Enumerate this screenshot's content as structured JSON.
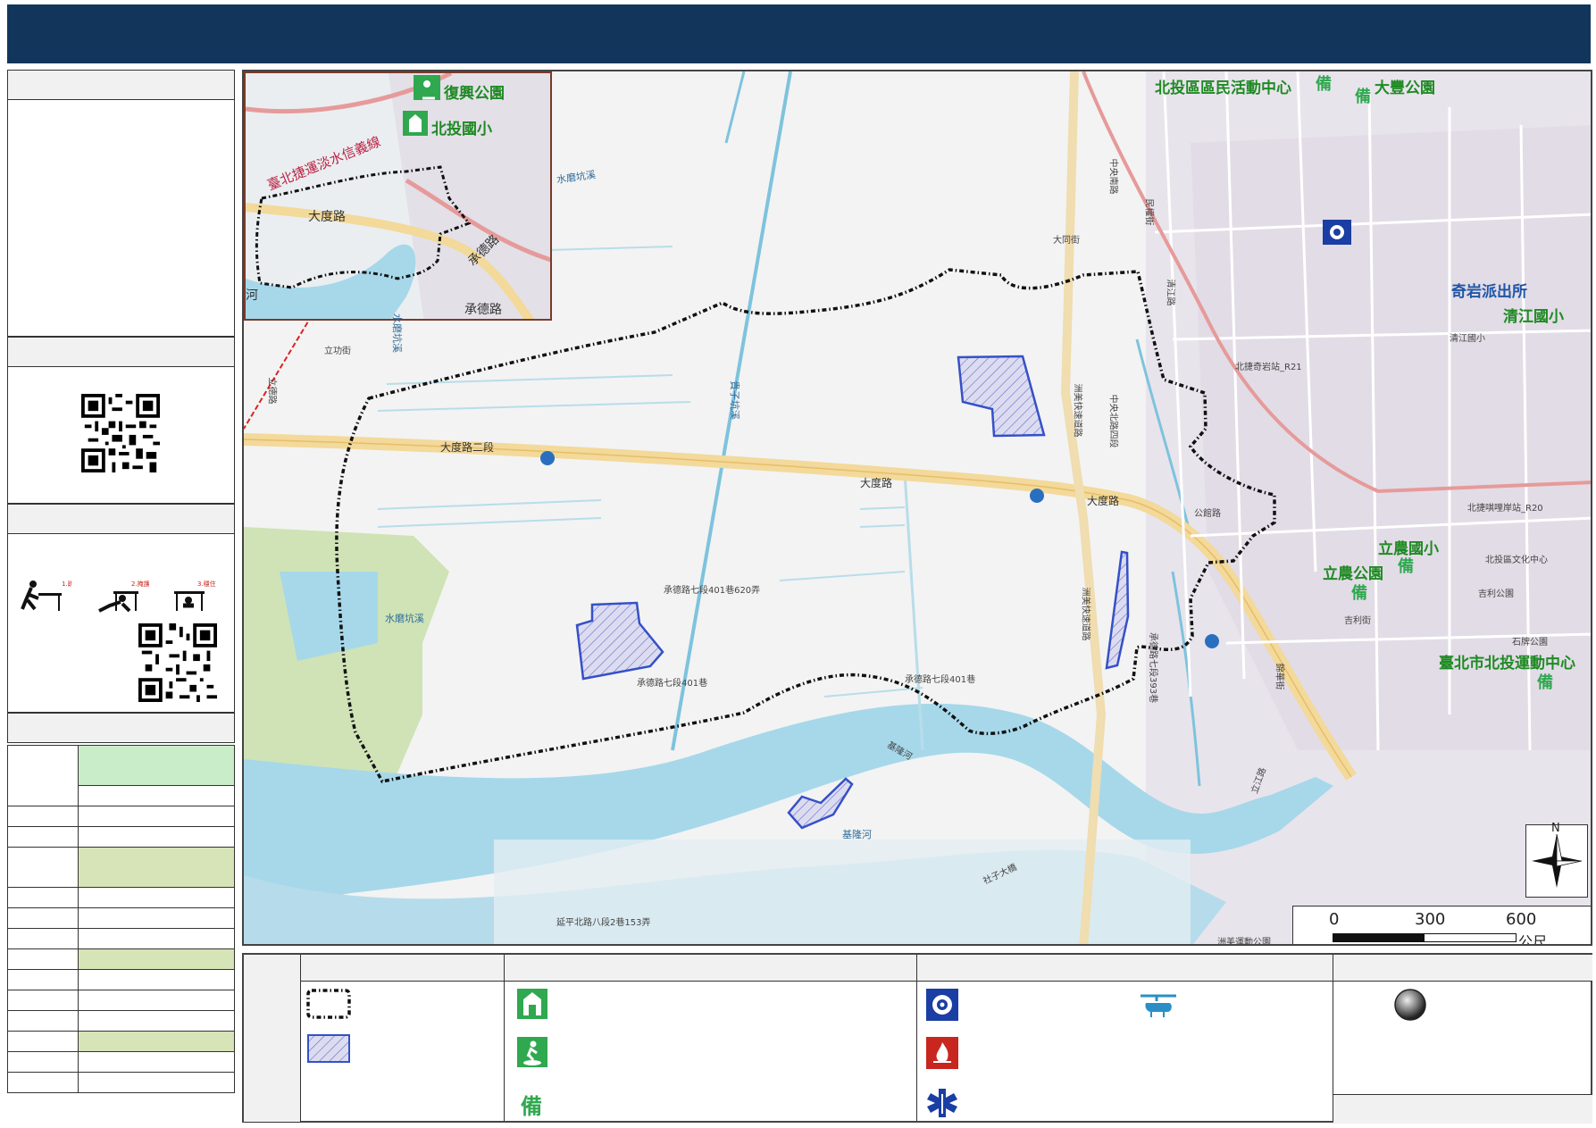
{
  "map": {
    "inset_labels": {
      "park": "復興公園",
      "school": "北投國小",
      "metro_line": "臺北捷運淡水信義線",
      "road_dadu": "大度路",
      "road_chengde": "承德路",
      "road_chengde2": "承德路",
      "river": "河"
    },
    "facility_labels": {
      "activity_center": "北投區區民活動中心",
      "dafeng_park": "大豐公園",
      "qiyan_police": "奇岩派出所",
      "qingjiang_school": "清江國小",
      "linong_school": "立農國小",
      "linong_park": "立農公園",
      "sports_center": "臺北市北投運動中心",
      "bei": "備"
    },
    "road_labels": {
      "dadu_2": "大度路二段",
      "dadu": "大度路",
      "dadu_b": "大度路",
      "chengde_620": "承德路七段401巷620弄",
      "chengde_401": "承德路七段401巷",
      "chengde_401b": "承德路七段401巷",
      "chengde_393": "承德路七段393巷",
      "shuimo": "水磨坑溪",
      "shuimo2": "水磨坑溪",
      "shuimo3": "水磨坑溪",
      "guizi": "貴子坑溪",
      "jilong": "基隆河",
      "jilong2": "基隆河",
      "shezi_bridge": "社子大橋",
      "zhouma": "洲美快速道路",
      "zhouma2": "洲美快速道路",
      "zhongyang": "中央北路四段",
      "yanping": "延平北路八段2巷153弄",
      "lishi": "立功街",
      "lian": "立德路",
      "zhongyang3": "中央南路",
      "mingfu": "民權街",
      "datong": "大同街",
      "qingjiang": "清江路",
      "gonglu": "公館路",
      "jinye": "錦華街",
      "zhouma_park": "洲美運動公園",
      "r21": "北捷奇岩站_R21",
      "r20": "北捷唭哩岸站_R20",
      "lijiang": "立江路",
      "shijun": "石牌公園",
      "jisheng": "吉利街",
      "jisheng2": "吉利公園",
      "wanliu": "北投區文化中心",
      "qingjiang_post": "清江國小"
    },
    "scale": {
      "t0": "0",
      "t1": "300",
      "t2": "600",
      "unit": "公尺"
    },
    "north": "N"
  },
  "colors": {
    "title_bar": "#12365b",
    "river": "#a6d8ea",
    "park_green": "#cfe3b6",
    "boundary": "#111111",
    "area_blue": "#3550c8",
    "facility_green": "#2fa84f",
    "police_blue": "#1a3ea3",
    "fire_red": "#c8271f"
  },
  "left_table": {
    "highlight_rows": [
      0,
      4,
      7,
      10
    ],
    "row_count": 14
  }
}
